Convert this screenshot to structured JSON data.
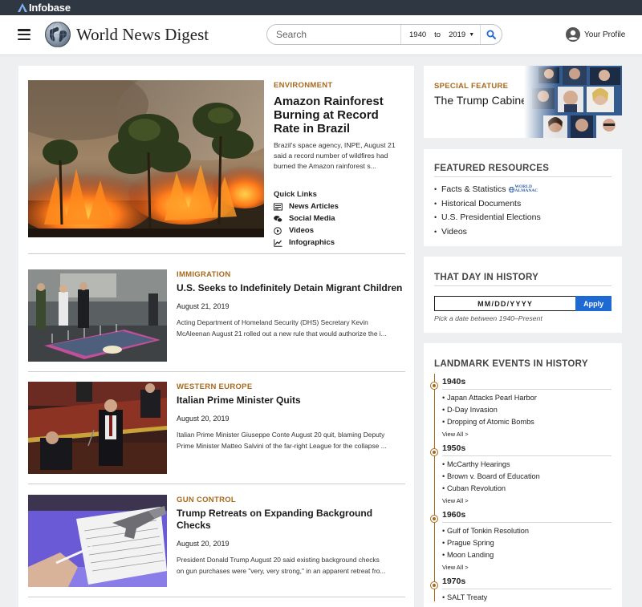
{
  "brand": {
    "company": "Infobase",
    "site_title": "World News Digest"
  },
  "search": {
    "placeholder": "Search",
    "year_from": "1940",
    "year_to_label": "to",
    "year_to": "2019"
  },
  "profile": {
    "label": "Your Profile"
  },
  "feature": {
    "category": "Environment",
    "headline": "Amazon Rainforest Burning at Record Rate in Brazil",
    "summary": "Brazil's space agency, INPE, August 21 said a record number of wildfires had burned the Amazon rainforest s...",
    "quick_links_title": "Quick Links",
    "quick_links": [
      {
        "label": "News Articles",
        "icon": "newspaper-icon"
      },
      {
        "label": "Social Media",
        "icon": "chat-bubbles-icon"
      },
      {
        "label": "Videos",
        "icon": "play-circle-icon"
      },
      {
        "label": "Infographics",
        "icon": "line-chart-icon"
      }
    ]
  },
  "stories": [
    {
      "category": "Immigration",
      "headline": "U.S. Seeks to Indefinitely Detain Migrant Children",
      "date": "August 21, 2019",
      "summary_1": "Acting Department of Homeland Security (DHS) Secretary Kevin",
      "summary_2": "McAleenan August 21 rolled out a new rule that would authorize the i..."
    },
    {
      "category": "Western Europe",
      "headline": "Italian Prime Minister Quits",
      "date": "August 20, 2019",
      "summary_1": "Italian Prime Minister Giuseppe Conte August 20 quit, blaming Deputy",
      "summary_2": "Prime Minister Matteo Salvini of the far-right League for the collapse ..."
    },
    {
      "category": "Gun Control",
      "headline": "Trump Retreats on Expanding Background Checks",
      "date": "August 20, 2019",
      "summary_1": "President Donald Trump August 20 said existing background checks",
      "summary_2": "on gun purchases were \"very, very strong,\" in an apparent retreat fro..."
    }
  ],
  "special_feature": {
    "category": "Special Feature",
    "title": "The Trump Cabinet"
  },
  "featured_resources": {
    "title": "Featured Resources",
    "items": [
      "Facts & Statistics",
      "Historical Documents",
      "U.S. Presidential Elections",
      "Videos"
    ],
    "badge_line1": "WORLD",
    "badge_line2": "ALMANAC"
  },
  "that_day": {
    "title": "That Day in History",
    "placeholder": "MM/DD/YYYY",
    "apply_label": "Apply",
    "hint": "Pick a date between 1940–Present"
  },
  "landmark": {
    "title": "Landmark Events in History",
    "view_all_label": "View All >",
    "decades": [
      {
        "label": "1940s",
        "events": [
          "Japan Attacks Pearl Harbor",
          "D-Day Invasion",
          "Dropping of Atomic Bombs"
        ]
      },
      {
        "label": "1950s",
        "events": [
          "McCarthy Hearings",
          "Brown v. Board of Education",
          "Cuban Revolution"
        ]
      },
      {
        "label": "1960s",
        "events": [
          "Gulf of Tonkin Resolution",
          "Prague Spring",
          "Moon Landing"
        ]
      },
      {
        "label": "1970s",
        "events": [
          "SALT Treaty"
        ]
      }
    ]
  },
  "colors": {
    "topbar": "#2f3743",
    "accent_category": "#a8691c",
    "apply_button": "#1f6ad2",
    "search_icon": "#1f6ad2"
  }
}
